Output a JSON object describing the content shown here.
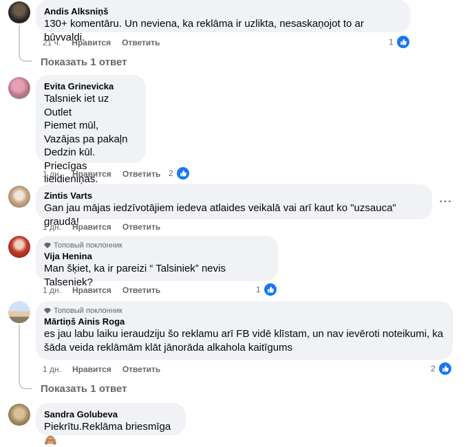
{
  "comments": [
    {
      "author": "Andis Alksniņš",
      "text": "130+ komentāru. Un neviena, ka reklāma ir uzlikta, nesaskaņojot to ar būvvaldi.",
      "time": "21 ч.",
      "like_label": "Нравится",
      "reply_label": "Ответить",
      "reactions": "1",
      "show_replies": "Показать 1 ответ"
    },
    {
      "author": "Evita Grinevicka",
      "text": "Talsniek iet uz Outlet\nPiemet mūl,\nVazājas pa pakaļn\nDedzin kūl.\nPriecīgas lieldieniņas.",
      "time": "1 дн.",
      "like_label": "Нравится",
      "reply_label": "Ответить",
      "reactions": "2"
    },
    {
      "author": "Zintis Varts",
      "text": "Gan jau mājas iedzīvotājiem iedeva atlaides veikalā vai arī kaut ko \"uzsauca\" graudā!",
      "time": "1 дн.",
      "like_label": "Нравится",
      "reply_label": "Ответить"
    },
    {
      "badge": "Топовый поклонник",
      "author": "Vija Henina",
      "text": "Man šķiet, ka ir pareizi “ Talsiniek” nevis Talseniek?",
      "time": "1 дн.",
      "like_label": "Нравится",
      "reply_label": "Ответить",
      "reactions": "1"
    },
    {
      "badge": "Топовый поклонник",
      "author": "Mārtiņš Ainis Roga",
      "text": "es jau labu laiku ieraudziju šo reklamu arī FB vidē klīstam, un nav ievēroti noteikumi, ka šāda veida reklāmām klāt jānorāda alkahola kaitīgums",
      "time": "1 дн.",
      "like_label": "Нравится",
      "reply_label": "Ответить",
      "reactions": "2",
      "show_replies": "Показать 1 ответ"
    },
    {
      "author": "Sandra Golubeva",
      "text": "Piekrītu.Reklāma briesmīga🙈"
    }
  ],
  "colors": {
    "bubble": "#f0f2f5",
    "like_blue": "#1877f2",
    "meta_gray": "#65676b",
    "text": "#050505"
  },
  "icons": {
    "like": "thumbs-up-icon",
    "badge": "diamond-icon",
    "more": "more-options-icon"
  }
}
